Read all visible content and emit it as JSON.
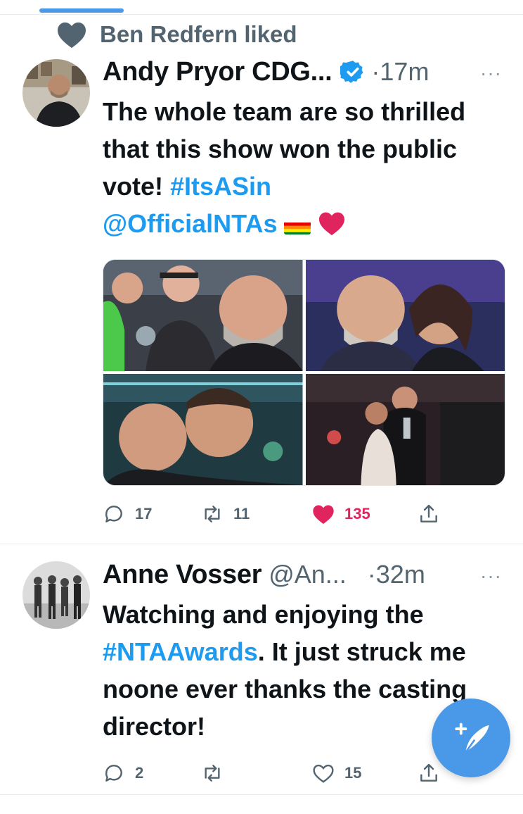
{
  "social_context": {
    "text": "Ben Redfern liked",
    "icon": "heart-icon"
  },
  "tweets": [
    {
      "name": "Andy Pryor CDG...",
      "handle": "",
      "verified": true,
      "time": "·17m",
      "more": "···",
      "text_parts": [
        "The whole team are so thrilled that this show won the public vote! ",
        "#ItsASin",
        "@OfficialNTAs"
      ],
      "emoji": [
        "rainbow-flag",
        "red-heart"
      ],
      "media_count": 4,
      "actions": {
        "replies": "17",
        "retweets": "11",
        "likes": "135",
        "liked": true
      }
    },
    {
      "name": "Anne Vosser",
      "handle": "@An...",
      "verified": false,
      "time": "·32m",
      "more": "···",
      "text_parts": [
        "Watching and enjoying the ",
        "#NTAAwards",
        ". It just struck me noone ever thanks the casting director!"
      ],
      "actions": {
        "replies": "2",
        "retweets": "",
        "likes": "15",
        "liked": false
      }
    }
  ],
  "fab": {
    "icon": "compose-tweet-icon"
  },
  "colors": {
    "accent": "#1d9bf0",
    "fab": "#4a99e9",
    "like": "#e0245e",
    "muted": "#536471"
  }
}
